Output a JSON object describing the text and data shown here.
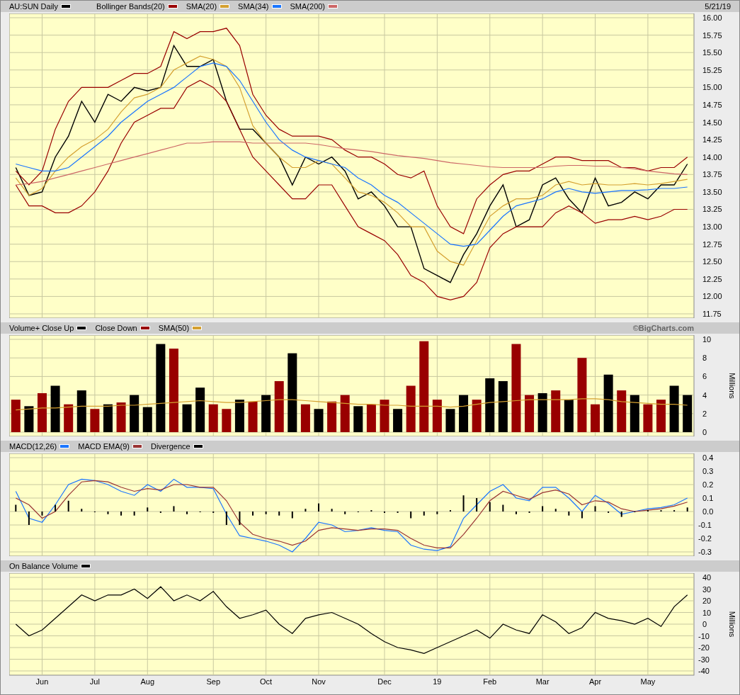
{
  "panels": [
    {
      "note": "5/21/19",
      "chart_data": {
        "type": "line",
        "grid": true,
        "ylim": [
          11.75,
          16.0
        ],
        "yticks": [
          {
            "value": 16,
            "label": "16.00"
          },
          {
            "value": 15.75,
            "label": "15.75"
          },
          {
            "value": 15.5,
            "label": "15.50"
          },
          {
            "value": 15.25,
            "label": "15.25"
          },
          {
            "value": 15,
            "label": "15.00"
          },
          {
            "value": 14.75,
            "label": "14.75"
          },
          {
            "value": 14.5,
            "label": "14.50"
          },
          {
            "value": 14.25,
            "label": "14.25"
          },
          {
            "value": 14,
            "label": "14.00"
          },
          {
            "value": 13.75,
            "label": "13.75"
          },
          {
            "value": 13.5,
            "label": "13.50"
          },
          {
            "value": 13.25,
            "label": "13.25"
          },
          {
            "value": 13,
            "label": "13.00"
          },
          {
            "value": 12.75,
            "label": "12.75"
          },
          {
            "value": 12.5,
            "label": "12.50"
          },
          {
            "value": 12.25,
            "label": "12.25"
          },
          {
            "value": 12,
            "label": "12.00"
          },
          {
            "value": 11.75,
            "label": "11.75"
          }
        ],
        "series": [
          {
            "name": "AU:SUN Daily",
            "color": "#000000",
            "values": [
              13.85,
              13.45,
              13.5,
              14.0,
              14.3,
              14.8,
              14.5,
              14.9,
              14.8,
              15.0,
              14.95,
              15.0,
              15.6,
              15.3,
              15.3,
              15.4,
              14.8,
              14.4,
              14.4,
              14.2,
              14.0,
              13.6,
              14.0,
              13.9,
              14.0,
              13.8,
              13.4,
              13.5,
              13.3,
              13.0,
              13.0,
              12.4,
              12.3,
              12.2,
              12.6,
              12.9,
              13.3,
              13.6,
              13.0,
              13.1,
              13.6,
              13.7,
              13.4,
              13.2,
              13.7,
              13.3,
              13.35,
              13.5,
              13.4,
              13.6,
              13.6,
              13.9
            ]
          },
          {
            "name": "Bollinger Bands(20)",
            "color": "#990000",
            "values": [
              13.8,
              13.6,
              13.8,
              14.4,
              14.8,
              15.0,
              15.0,
              15.0,
              15.1,
              15.2,
              15.2,
              15.3,
              15.8,
              15.7,
              15.8,
              15.8,
              15.85,
              15.6,
              14.9,
              14.6,
              14.4,
              14.3,
              14.3,
              14.3,
              14.25,
              14.1,
              14.0,
              14.0,
              13.9,
              13.75,
              13.7,
              13.8,
              13.3,
              13.0,
              12.9,
              13.4,
              13.6,
              13.75,
              13.8,
              13.8,
              13.9,
              14.0,
              14.0,
              13.95,
              13.95,
              13.95,
              13.85,
              13.85,
              13.8,
              13.85,
              13.85,
              14.0
            ]
          },
          {
            "color": "#990000",
            "values": [
              13.6,
              13.3,
              13.3,
              13.2,
              13.2,
              13.3,
              13.5,
              13.8,
              14.2,
              14.5,
              14.6,
              14.7,
              14.7,
              15.0,
              15.1,
              15.0,
              14.8,
              14.4,
              14.0,
              13.8,
              13.6,
              13.4,
              13.4,
              13.6,
              13.6,
              13.3,
              13.0,
              12.9,
              12.8,
              12.6,
              12.3,
              12.2,
              12.0,
              11.95,
              12.0,
              12.2,
              12.7,
              12.9,
              13.0,
              13.0,
              13.0,
              13.2,
              13.3,
              13.2,
              13.05,
              13.1,
              13.1,
              13.15,
              13.1,
              13.15,
              13.25,
              13.25
            ]
          },
          {
            "name": "SMA(20)",
            "color": "#d4a030",
            "values": [
              13.7,
              13.45,
              13.55,
              13.8,
              14.0,
              14.15,
              14.25,
              14.4,
              14.65,
              14.85,
              14.9,
              15.0,
              15.25,
              15.35,
              15.45,
              15.4,
              15.3,
              15.0,
              14.45,
              14.2,
              14.0,
              13.85,
              13.85,
              13.95,
              13.9,
              13.7,
              13.5,
              13.45,
              13.35,
              13.2,
              13.0,
              13.0,
              12.65,
              12.5,
              12.45,
              12.8,
              13.15,
              13.3,
              13.4,
              13.4,
              13.45,
              13.6,
              13.65,
              13.6,
              13.62,
              13.6,
              13.6,
              13.62,
              13.6,
              13.62,
              13.65,
              13.68
            ]
          },
          {
            "name": "SMA(34)",
            "color": "#1a75ff",
            "values": [
              13.9,
              13.85,
              13.8,
              13.8,
              13.85,
              14.0,
              14.15,
              14.3,
              14.5,
              14.65,
              14.8,
              14.9,
              15.0,
              15.15,
              15.3,
              15.35,
              15.3,
              15.1,
              14.8,
              14.5,
              14.25,
              14.1,
              14.0,
              13.95,
              13.9,
              13.85,
              13.7,
              13.6,
              13.45,
              13.35,
              13.2,
              13.05,
              12.9,
              12.75,
              12.72,
              12.75,
              12.95,
              13.15,
              13.3,
              13.35,
              13.4,
              13.5,
              13.55,
              13.5,
              13.48,
              13.5,
              13.52,
              13.52,
              13.53,
              13.55,
              13.55,
              13.57
            ]
          },
          {
            "name": "SMA(200)",
            "color": "#cc6666",
            "values": [
              13.6,
              13.62,
              13.65,
              13.7,
              13.75,
              13.8,
              13.85,
              13.9,
              13.95,
              14.0,
              14.05,
              14.1,
              14.15,
              14.2,
              14.2,
              14.22,
              14.22,
              14.22,
              14.2,
              14.2,
              14.2,
              14.2,
              14.2,
              14.18,
              14.15,
              14.12,
              14.1,
              14.08,
              14.05,
              14.02,
              14.0,
              13.98,
              13.95,
              13.92,
              13.9,
              13.88,
              13.86,
              13.85,
              13.85,
              13.85,
              13.85,
              13.87,
              13.88,
              13.88,
              13.87,
              13.87,
              13.85,
              13.83,
              13.8,
              13.78,
              13.76,
              13.75
            ]
          }
        ]
      }
    },
    {
      "note": "©BigCharts.com",
      "chart_data": {
        "type": "bar",
        "grid": true,
        "stacked": true,
        "ylim": [
          0,
          10
        ],
        "ylabel": "Millions",
        "yticks": [
          {
            "value": 0,
            "label": "0"
          },
          {
            "value": 2,
            "label": "2"
          },
          {
            "value": 4,
            "label": "4"
          },
          {
            "value": 6,
            "label": "6"
          },
          {
            "value": 8,
            "label": "8"
          },
          {
            "value": 10,
            "label": "10"
          }
        ],
        "series": [
          {
            "name": "Volume+ Close Up",
            "color": "#000000",
            "values": [
              null,
              2.8,
              null,
              5,
              null,
              4.5,
              null,
              3,
              null,
              4,
              2.7,
              9.5,
              null,
              3,
              4.8,
              null,
              null,
              3.5,
              null,
              4,
              null,
              8.5,
              null,
              2.5,
              null,
              null,
              2.8,
              null,
              null,
              2.5,
              null,
              null,
              null,
              2.5,
              4,
              null,
              5.8,
              5.5,
              null,
              null,
              4.2,
              null,
              3.5,
              null,
              null,
              6.2,
              null,
              4,
              null,
              null,
              5,
              4
            ]
          },
          {
            "name": "Close Down",
            "color": "#990000",
            "values": [
              3.5,
              null,
              4.2,
              null,
              3,
              null,
              2.5,
              null,
              3.2,
              null,
              null,
              null,
              9,
              null,
              null,
              3,
              2.5,
              null,
              3.3,
              null,
              5.5,
              null,
              3,
              null,
              3.3,
              4,
              null,
              3,
              3.5,
              null,
              5,
              9.8,
              3.5,
              null,
              null,
              3.5,
              null,
              null,
              9.5,
              4,
              null,
              4.5,
              null,
              8,
              3,
              null,
              4.5,
              null,
              3,
              3.5,
              null,
              null
            ]
          },
          {
            "name": "SMA(50)",
            "color": "#d4a030",
            "type": "line",
            "values": [
              2.4,
              2.5,
              2.6,
              2.6,
              2.7,
              2.8,
              2.8,
              2.8,
              2.9,
              2.9,
              3.0,
              3.1,
              3.2,
              3.3,
              3.4,
              3.3,
              3.2,
              3.2,
              3.3,
              3.4,
              3.5,
              3.5,
              3.4,
              3.3,
              3.2,
              3.1,
              3.0,
              3.0,
              2.9,
              2.9,
              2.8,
              2.8,
              2.8,
              2.7,
              2.8,
              3.0,
              3.2,
              3.3,
              3.4,
              3.5,
              3.5,
              3.5,
              3.5,
              3.6,
              3.6,
              3.5,
              3.3,
              3.2,
              3.1,
              3.0,
              3.0,
              2.9
            ]
          }
        ]
      }
    },
    {
      "chart_data": {
        "type": "line",
        "grid": true,
        "ylim": [
          -0.3,
          0.4
        ],
        "yticks": [
          {
            "value": 0.4,
            "label": "0.4"
          },
          {
            "value": 0.3,
            "label": "0.3"
          },
          {
            "value": 0.2,
            "label": "0.2"
          },
          {
            "value": 0.1,
            "label": "0.1"
          },
          {
            "value": 0,
            "label": "0.0"
          },
          {
            "value": -0.1,
            "label": "-0.1"
          },
          {
            "value": -0.2,
            "label": "-0.2"
          },
          {
            "value": -0.3,
            "label": "-0.3"
          }
        ],
        "series": [
          {
            "name": "MACD(12,26)",
            "color": "#1a75ff",
            "values": [
              0.15,
              -0.05,
              -0.08,
              0.05,
              0.2,
              0.24,
              0.23,
              0.2,
              0.15,
              0.12,
              0.2,
              0.15,
              0.24,
              0.18,
              0.18,
              0.17,
              -0.02,
              -0.18,
              -0.2,
              -0.22,
              -0.25,
              -0.3,
              -0.2,
              -0.08,
              -0.1,
              -0.15,
              -0.14,
              -0.12,
              -0.14,
              -0.15,
              -0.25,
              -0.28,
              -0.29,
              -0.26,
              -0.05,
              0.05,
              0.15,
              0.2,
              0.1,
              0.08,
              0.18,
              0.18,
              0.1,
              0.0,
              0.12,
              0.06,
              -0.02,
              0.0,
              0.02,
              0.03,
              0.05,
              0.1
            ]
          },
          {
            "name": "MACD EMA(9)",
            "color": "#993333",
            "values": [
              0.1,
              0.05,
              -0.05,
              0.0,
              0.12,
              0.22,
              0.23,
              0.22,
              0.18,
              0.15,
              0.17,
              0.16,
              0.2,
              0.2,
              0.18,
              0.18,
              0.08,
              -0.08,
              -0.17,
              -0.2,
              -0.22,
              -0.25,
              -0.22,
              -0.14,
              -0.12,
              -0.13,
              -0.14,
              -0.13,
              -0.13,
              -0.14,
              -0.2,
              -0.25,
              -0.27,
              -0.27,
              -0.17,
              -0.05,
              0.08,
              0.15,
              0.12,
              0.09,
              0.14,
              0.16,
              0.13,
              0.05,
              0.08,
              0.07,
              0.02,
              0.0,
              0.01,
              0.02,
              0.04,
              0.07
            ]
          },
          {
            "name": "Divergence",
            "color": "#000000",
            "type": "bar",
            "values": [
              0.05,
              -0.1,
              -0.03,
              0.05,
              0.08,
              0.02,
              0,
              -0.02,
              -0.03,
              -0.03,
              0.03,
              -0.01,
              0.04,
              -0.02,
              0,
              -0.01,
              -0.1,
              -0.1,
              -0.03,
              -0.02,
              -0.03,
              -0.05,
              0.02,
              0.06,
              0.02,
              -0.02,
              0,
              0.01,
              -0.01,
              -0.01,
              -0.05,
              -0.03,
              -0.02,
              0.01,
              0.12,
              0.1,
              0.07,
              0.05,
              -0.02,
              -0.01,
              0.04,
              0.02,
              -0.03,
              -0.05,
              0.04,
              -0.01,
              -0.04,
              0,
              0.01,
              0.01,
              0.01,
              0.03
            ]
          }
        ]
      }
    },
    {
      "chart_data": {
        "type": "line",
        "grid": true,
        "categories": [
          null,
          null,
          "Jun",
          null,
          null,
          null,
          "Jul",
          null,
          null,
          null,
          "Aug",
          null,
          null,
          null,
          null,
          "Sep",
          null,
          null,
          null,
          "Oct",
          null,
          null,
          null,
          "Nov",
          null,
          null,
          null,
          null,
          "Dec",
          null,
          null,
          null,
          "19",
          null,
          null,
          null,
          "Feb",
          null,
          null,
          null,
          "Mar",
          null,
          null,
          null,
          "Apr",
          null,
          null,
          null,
          "May",
          null,
          null,
          null
        ],
        "ylim": [
          -40,
          40
        ],
        "ylabel": "Millions",
        "yticks": [
          {
            "value": 40,
            "label": "40"
          },
          {
            "value": 30,
            "label": "30"
          },
          {
            "value": 20,
            "label": "20"
          },
          {
            "value": 10,
            "label": "10"
          },
          {
            "value": 0,
            "label": "0"
          },
          {
            "value": -10,
            "label": "-10"
          },
          {
            "value": -20,
            "label": "-20"
          },
          {
            "value": -30,
            "label": "-30"
          },
          {
            "value": -40,
            "label": "-40"
          }
        ],
        "series": [
          {
            "name": "On Balance Volume",
            "color": "#000000",
            "values": [
              0,
              -10,
              -5,
              5,
              15,
              25,
              20,
              25,
              25,
              30,
              22,
              32,
              20,
              25,
              20,
              28,
              15,
              5,
              8,
              12,
              0,
              -8,
              5,
              8,
              10,
              5,
              0,
              -8,
              -15,
              -20,
              -22,
              -25,
              -20,
              -15,
              -10,
              -5,
              -12,
              0,
              -5,
              -8,
              8,
              2,
              -8,
              -3,
              10,
              5,
              3,
              0,
              5,
              -2,
              15,
              25
            ]
          }
        ]
      }
    }
  ]
}
